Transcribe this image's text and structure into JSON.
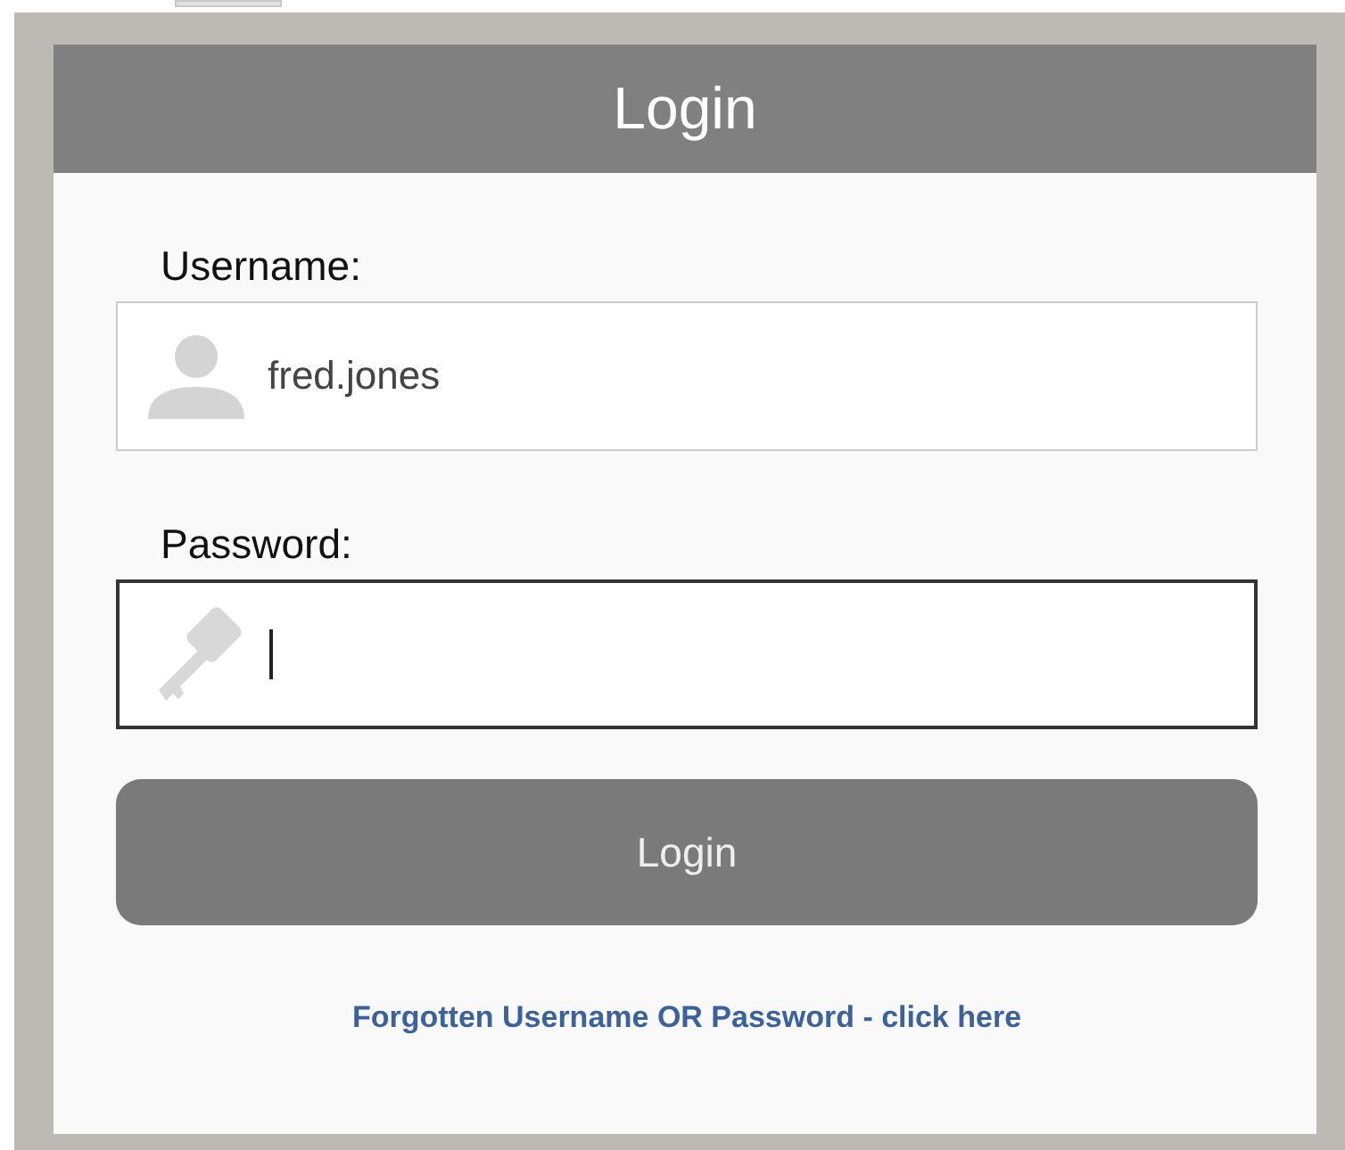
{
  "header": {
    "title": "Login"
  },
  "fields": [
    {
      "label": "Username:",
      "kind": "user",
      "value": "fred.jones",
      "focused": false
    },
    {
      "label": "Password:",
      "kind": "key",
      "focused": true
    }
  ],
  "button": {
    "label": "Login"
  },
  "link": {
    "text": "Forgotten Username OR Password - click here"
  }
}
